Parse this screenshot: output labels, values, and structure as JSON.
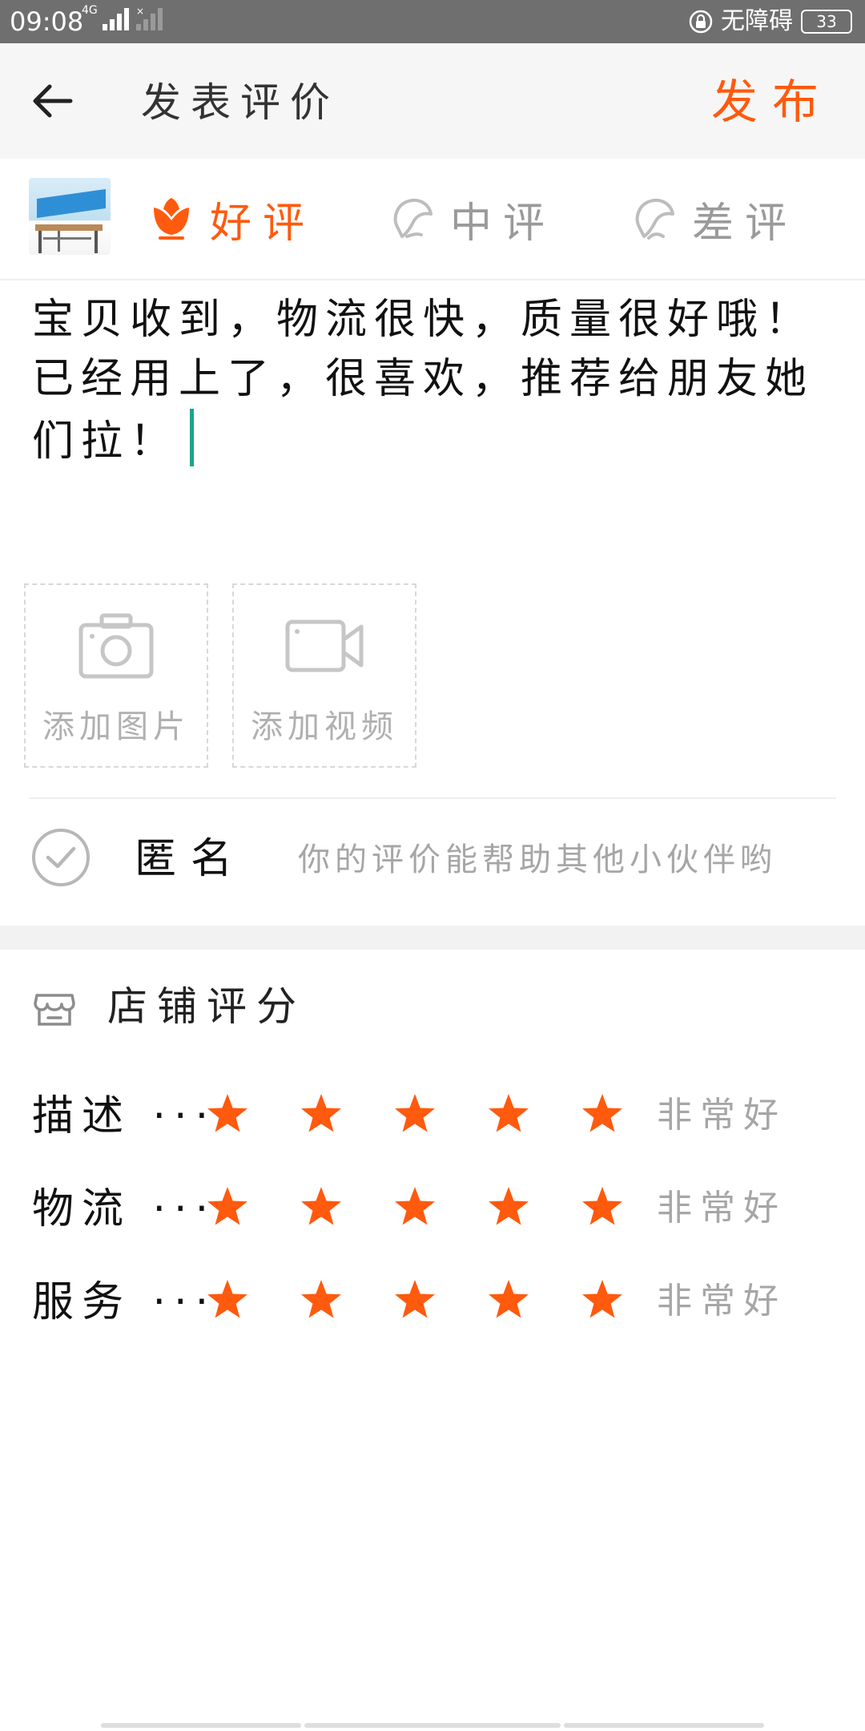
{
  "status_bar": {
    "time": "09:08",
    "network": "4G",
    "accessibility": "无障碍",
    "battery": "33"
  },
  "app_bar": {
    "title": "发表评价",
    "publish": "发布"
  },
  "rating_types": [
    {
      "label": "好评",
      "icon": "flower-icon",
      "selected": true
    },
    {
      "label": "中评",
      "icon": "neutral-face-icon",
      "selected": false
    },
    {
      "label": "差评",
      "icon": "sad-face-icon",
      "selected": false
    }
  ],
  "review": {
    "text": "宝贝收到，物流很快，质量很好哦！已经用上了，很喜欢，推荐给朋友她们拉！"
  },
  "media": {
    "add_photo": "添加图片",
    "add_video": "添加视频"
  },
  "anonymous": {
    "label": "匿名",
    "hint": "你的评价能帮助其他小伙伴哟"
  },
  "shop_rating": {
    "title": "店铺评分",
    "rows": [
      {
        "label": "描述 ···",
        "stars": 5,
        "max_stars": 5,
        "text": "非常好"
      },
      {
        "label": "物流 ···",
        "stars": 5,
        "max_stars": 5,
        "text": "非常好"
      },
      {
        "label": "服务 ···",
        "stars": 5,
        "max_stars": 5,
        "text": "非常好"
      }
    ]
  },
  "colors": {
    "accent": "#ff5a0e",
    "muted": "#a6a6a6",
    "caret": "#1aa58a"
  }
}
